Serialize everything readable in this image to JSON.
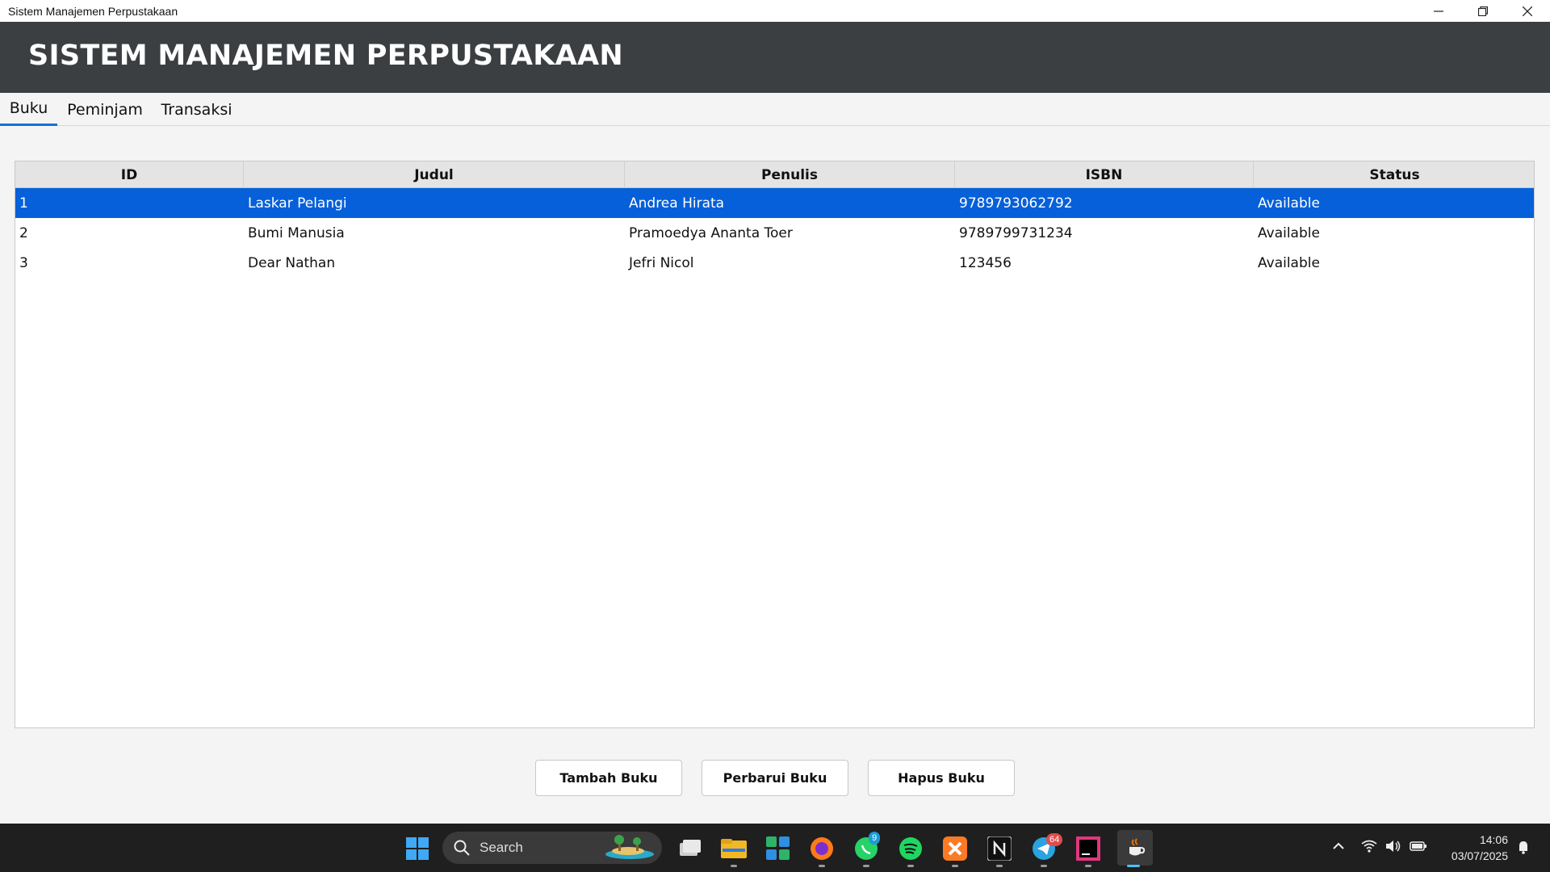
{
  "window": {
    "title": "Sistem Manajemen Perpustakaan"
  },
  "header": {
    "title": "SISTEM MANAJEMEN PERPUSTAKAAN"
  },
  "tabs": [
    {
      "label": "Buku",
      "active": true
    },
    {
      "label": "Peminjam",
      "active": false
    },
    {
      "label": "Transaksi",
      "active": false
    }
  ],
  "table": {
    "columns": [
      "ID",
      "Judul",
      "Penulis",
      "ISBN",
      "Status"
    ],
    "rows": [
      {
        "id": "1",
        "judul": "Laskar Pelangi",
        "penulis": "Andrea Hirata",
        "isbn": "9789793062792",
        "status": "Available",
        "selected": true
      },
      {
        "id": "2",
        "judul": "Bumi Manusia",
        "penulis": "Pramoedya Ananta Toer",
        "isbn": "9789799731234",
        "status": "Available",
        "selected": false
      },
      {
        "id": "3",
        "judul": "Dear Nathan",
        "penulis": "Jefri Nicol",
        "isbn": "123456",
        "status": "Available",
        "selected": false
      }
    ]
  },
  "buttons": {
    "add": "Tambah Buku",
    "update": "Perbarui Buku",
    "delete": "Hapus Buku"
  },
  "taskbar": {
    "search_label": "Search",
    "whatsapp_badge": "9",
    "telegram_badge": "64",
    "time": "14:06",
    "date": "03/07/2025"
  },
  "colors": {
    "header_bg": "#3b3f42",
    "selection": "#0560d9",
    "tab_accent": "#1a6fd6",
    "taskbar_bg": "#1f1f1f"
  }
}
